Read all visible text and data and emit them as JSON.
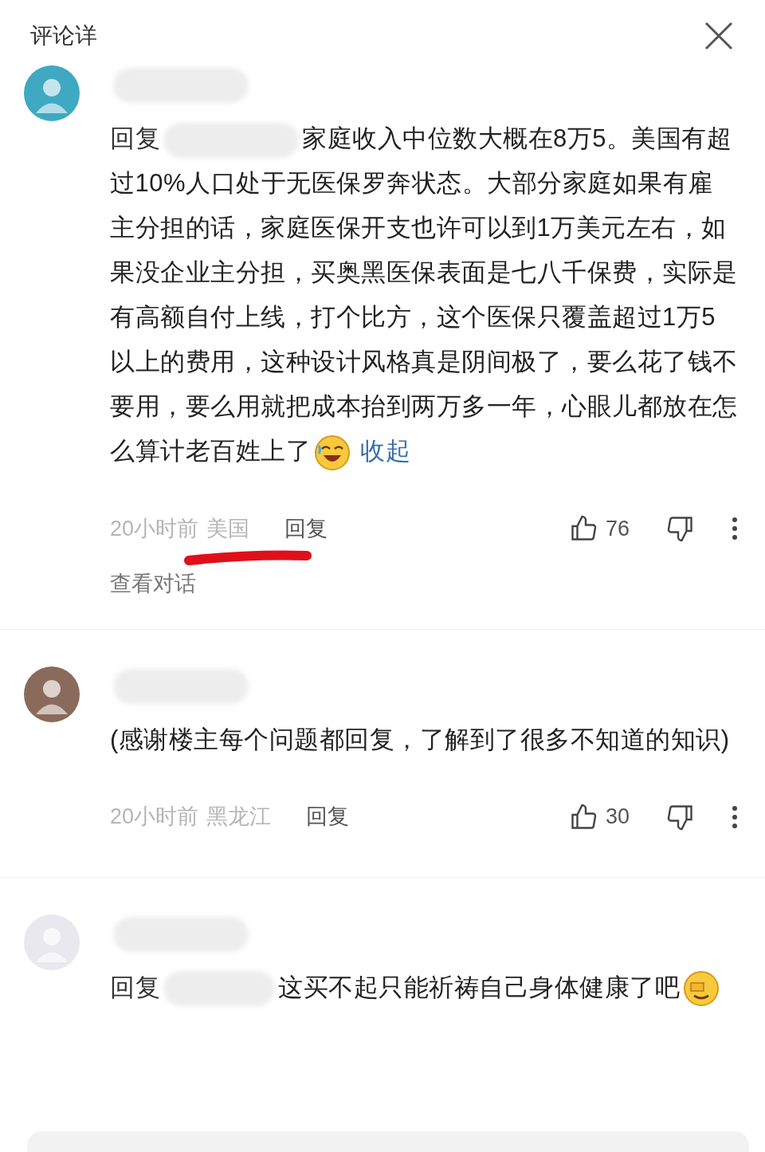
{
  "header": {
    "title": "评论详"
  },
  "comments": [
    {
      "reply_prefix": "回复",
      "text": "家庭收入中位数大概在8万5。美国有超过10%人口处于无医保罗奔状态。大部分家庭如果有雇主分担的话，家庭医保开支也许可以到1万美元左右，如果没企业主分担，买奥黑医保表面是七八千保费，实际是有高额自付上线，打个比方，这个医保只覆盖超过1万5以上的费用，这种设计风格真是阴间极了，要么花了钱不要用，要么用就把成本抬到两万多一年，心眼儿都放在怎么算计老百姓上了",
      "emoji": {
        "kind": "laughing"
      },
      "collapse_link": "收起",
      "time": "20小时前",
      "location": "美国",
      "reply_button": "回复",
      "likes": "76",
      "underlined": true,
      "view_conversation": "查看对话"
    },
    {
      "text": "(感谢楼主每个问题都回复，了解到了很多不知道的知识)",
      "time": "20小时前",
      "location": "黑龙江",
      "reply_button": "回复",
      "likes": "30"
    },
    {
      "reply_prefix": "回复",
      "text": "这买不起只能祈祷自己身体健康了吧",
      "emoji": {
        "kind": "facepalm"
      }
    }
  ]
}
